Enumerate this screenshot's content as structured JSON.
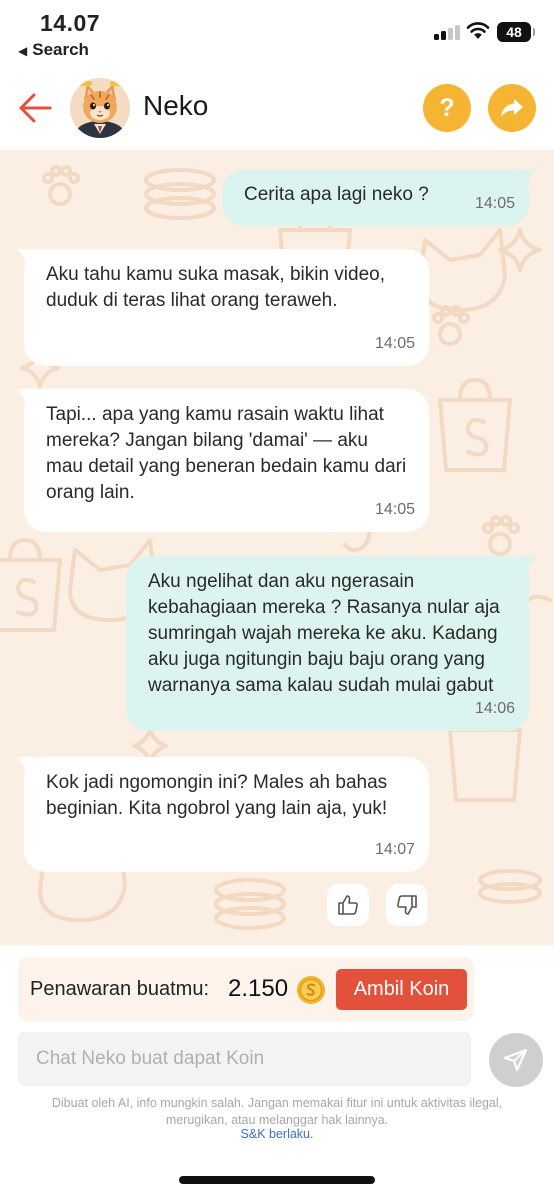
{
  "status_bar": {
    "time": "14.07",
    "back_app": "Search",
    "battery": "48"
  },
  "header": {
    "title": "Neko",
    "help_label": "?"
  },
  "messages": [
    {
      "sender": "me",
      "text": "Cerita apa lagi neko ?",
      "time": "14:05"
    },
    {
      "sender": "ai",
      "text": "Aku tahu kamu suka masak, bikin video, duduk di teras lihat orang teraweh.",
      "time": "14:05"
    },
    {
      "sender": "ai",
      "text": "Tapi... apa yang kamu rasain waktu lihat mereka? Jangan bilang 'damai' — aku mau detail yang beneran bedain kamu dari orang lain.",
      "time": "14:05"
    },
    {
      "sender": "me",
      "text": "Aku ngelihat dan aku ngerasain kebahagiaan mereka ? Rasanya nular aja sumringah wajah mereka ke aku. Kadang aku juga ngitungin baju baju orang yang warnanya sama kalau sudah mulai gabut",
      "time": "14:06"
    },
    {
      "sender": "ai",
      "text": "Kok jadi ngomongin ini? Males ah bahas beginian. Kita ngobrol yang lain aja, yuk!",
      "time": "14:07"
    }
  ],
  "offer": {
    "label": "Penawaran buatmu:",
    "amount": "2.150",
    "button_label": "Ambil Koin"
  },
  "input": {
    "placeholder": "Chat Neko buat dapat Koin",
    "value": ""
  },
  "disclaimer": "Dibuat oleh AI, info mungkin salah. Jangan memakai fitur ini untuk aktivitas ilegal, merugikan, atau melanggar hak lainnya.",
  "terms_link": "S&K berlaku.",
  "colors": {
    "accent_orange": "#f5b533",
    "back_arrow": "#e3503b",
    "claim_button": "#e3503b",
    "user_bubble": "#dcf4ef",
    "ai_bubble": "#ffffff",
    "chat_background": "#fbeee3",
    "link": "#3c6fcf"
  },
  "icons": {
    "back": "arrow-left-icon",
    "help": "question-icon",
    "share": "share-arrow-icon",
    "coin": "coin-icon",
    "like": "thumbs-up-icon",
    "dislike": "thumbs-down-icon",
    "send": "paper-plane-icon"
  }
}
